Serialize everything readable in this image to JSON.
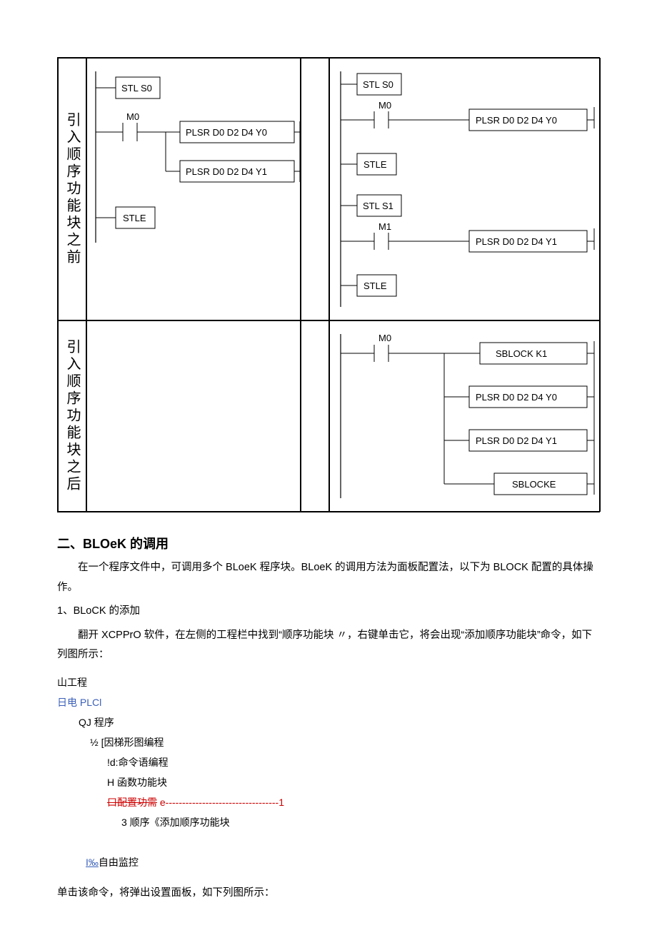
{
  "table": {
    "row1_label": "引入顺序功能块之前",
    "row2_label": "引入顺序功能块之后",
    "diagrams": {
      "tl": {
        "stl_s0": "STL S0",
        "m0": "M0",
        "plsr1": "PLSR D0 D2 D4 Y0",
        "plsr2": "PLSR D0 D2 D4 Y1",
        "stle": "STLE"
      },
      "tr": {
        "stl_s0": "STL S0",
        "m0": "M0",
        "plsr1": "PLSR D0 D2 D4 Y0",
        "stle1": "STLE",
        "stl_s1": "STL S1",
        "m1": "M1",
        "plsr2": "PLSR D0 D2 D4 Y1",
        "stle2": "STLE"
      },
      "br": {
        "m0": "M0",
        "sblock": "SBLOCK  K1",
        "plsr1": "PLSR D0 D2 D4 Y0",
        "plsr2": "PLSR D0 D2 D4 Y1",
        "sblocke": "SBLOCKE"
      }
    }
  },
  "section": {
    "heading_num": "二、",
    "heading_title": "BLOeK 的调用",
    "para1": "在一个程序文件中，可调用多个 BLoeK 程序块。BLoeK 的调用方法为面板配置法，以下为 BLOCK 配置的具体操作。",
    "item1": "1、BLoCK 的添加",
    "para2": "翻开 XCPPrO 软件，在左侧的工程栏中找到“顺序功能块 〃，右键单击它，将会出现“添加顺序功能块”命令，如下列图所示：",
    "para3": "单击该命令，将弹出设置面板，如下列图所示："
  },
  "tree": {
    "n0": "山工程",
    "n1": "日电 PLCl",
    "n2": "QJ 程序",
    "n3": "½ [因梯形图编程",
    "n4": "!d:命令语编程",
    "n5": "H 函数功能块",
    "n6a": "口配置功需",
    "n6b": " e----------------------------------1",
    "n7": "3 顺序《添加顺序功能块",
    "n8a": "I‰",
    "n8b": "自由监控"
  }
}
